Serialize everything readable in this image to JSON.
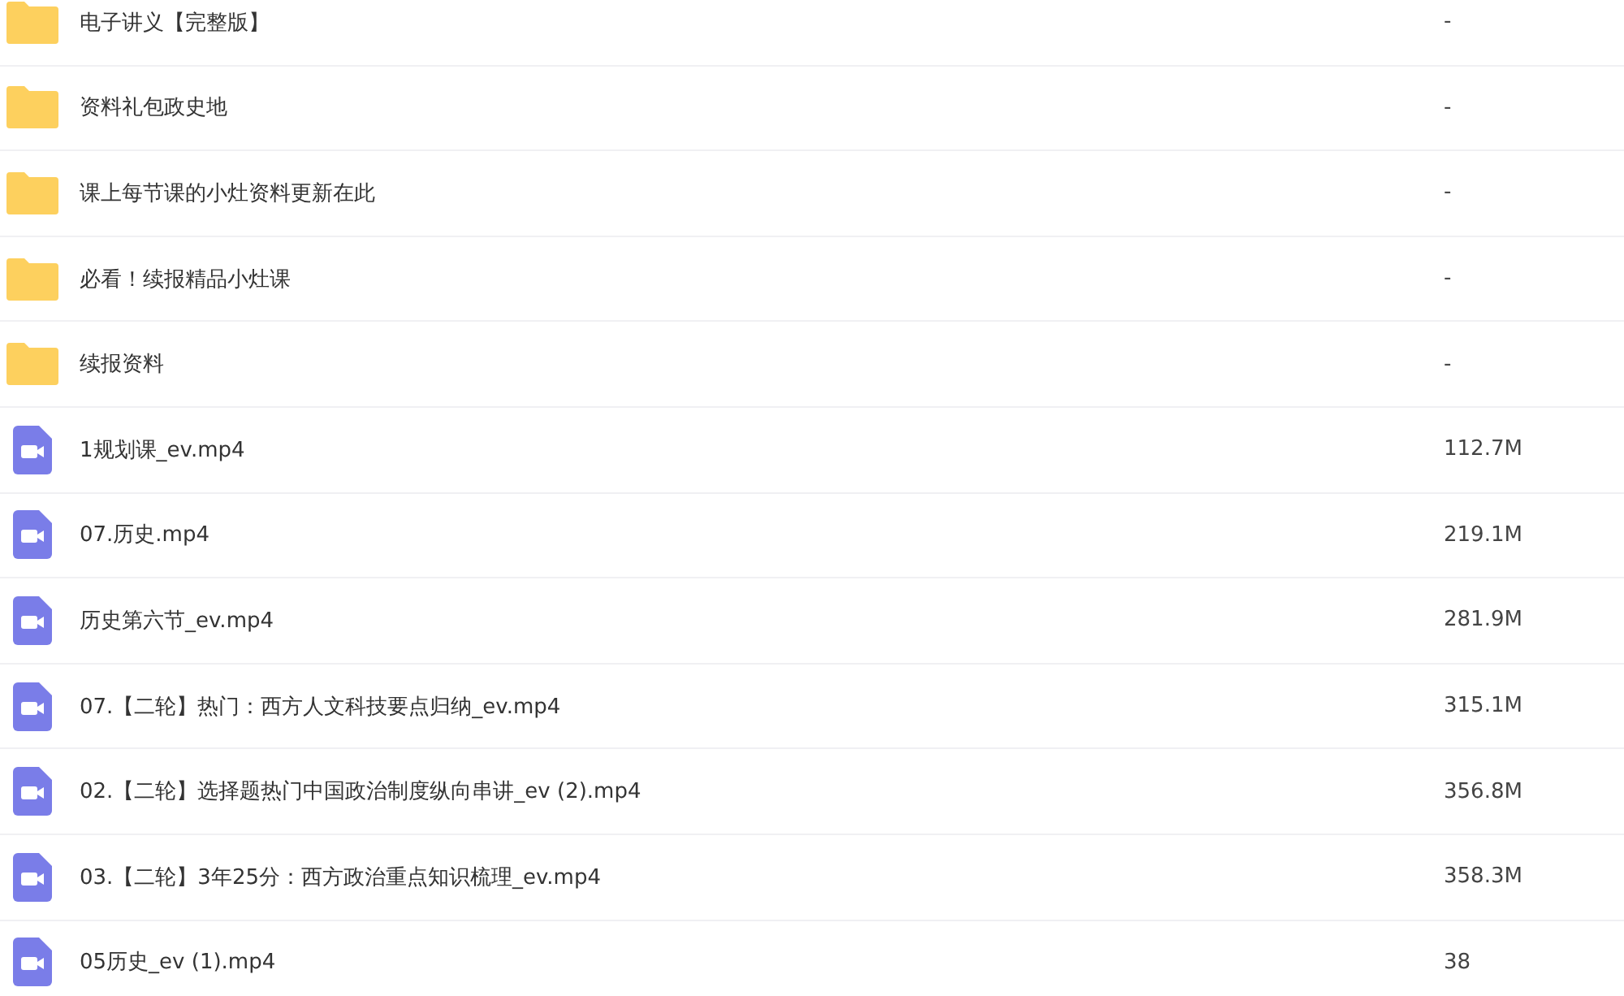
{
  "files": [
    {
      "kind": "folder",
      "name": "电子讲义【完整版】",
      "size": "-"
    },
    {
      "kind": "folder",
      "name": "资料礼包政史地",
      "size": "-"
    },
    {
      "kind": "folder",
      "name": "课上每节课的小灶资料更新在此",
      "size": "-"
    },
    {
      "kind": "folder",
      "name": "必看！续报精品小灶课",
      "size": "-"
    },
    {
      "kind": "folder",
      "name": "续报资料",
      "size": "-"
    },
    {
      "kind": "video",
      "name": "1规划课_ev.mp4",
      "size": "112.7M"
    },
    {
      "kind": "video",
      "name": "07.历史.mp4",
      "size": "219.1M"
    },
    {
      "kind": "video",
      "name": "历史第六节_ev.mp4",
      "size": "281.9M"
    },
    {
      "kind": "video",
      "name": "07.【二轮】热门：西方人文科技要点归纳_ev.mp4",
      "size": "315.1M"
    },
    {
      "kind": "video",
      "name": "02.【二轮】选择题热门中国政治制度纵向串讲_ev (2).mp4",
      "size": "356.8M"
    },
    {
      "kind": "video",
      "name": "03.【二轮】3年25分：西方政治重点知识梳理_ev.mp4",
      "size": "358.3M"
    },
    {
      "kind": "video",
      "name": "05历史_ev (1).mp4",
      "size": "38"
    }
  ]
}
